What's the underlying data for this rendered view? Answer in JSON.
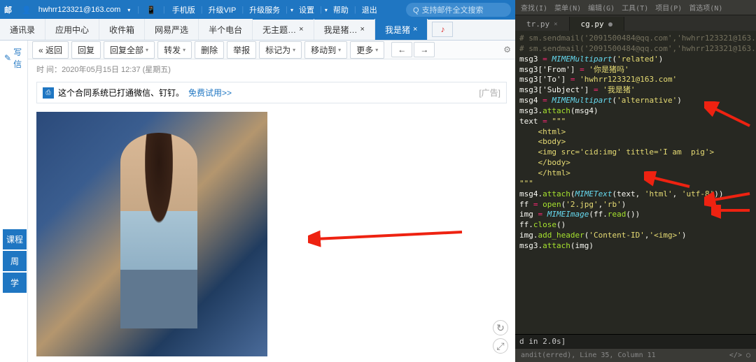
{
  "mail": {
    "brand": "邮",
    "user_email": "hwhrr123321@163.com",
    "top_links": [
      "手机版",
      "升级VIP",
      "升级服务",
      "设置",
      "帮助",
      "退出"
    ],
    "search_placeholder": "支持邮件全文搜索",
    "static_tabs": [
      "通讯录",
      "应用中心",
      "收件箱",
      "网易严选",
      "半个电台"
    ],
    "closable_tabs": [
      "无主题…",
      "我是猪…",
      "我是猪"
    ],
    "active_tab_index": 2,
    "compose": "写信",
    "toolbar": {
      "back": "« 返回",
      "reply": "回复",
      "reply_all": "回复全部",
      "forward": "转发",
      "delete": "删除",
      "report": "举报",
      "mark": "标记为",
      "move": "移动到",
      "more": "更多"
    },
    "meta": {
      "label": "时  间：",
      "value": "2020年05月15日 12:37 (星期五)"
    },
    "ad": {
      "text": "这个合同系统已打通微信、钉钉。",
      "link": "免费试用>>",
      "tag": "[广告]"
    },
    "side_labels": [
      "课程",
      "周",
      "学"
    ],
    "controls": {
      "rotate": "↻",
      "fit": "⤢"
    }
  },
  "editor": {
    "top_menu": [
      "查找(I)",
      "菜单(N)",
      "编辑(G)",
      "工具(T)",
      "项目(P)",
      "首选项(N)"
    ],
    "tabs": [
      {
        "name": "tr.py",
        "active": false
      },
      {
        "name": "cg.py",
        "active": true
      }
    ],
    "code_lines": [
      {
        "t": "cmt",
        "s": "# sm.sendmail('2091500484@qq.com','hwhrr123321@163."
      },
      {
        "t": "cmt",
        "s": "# sm.sendmail('2091500484@qq.com','hwhrr123321@163."
      },
      {
        "t": "assign",
        "v": "msg3",
        "rhs": [
          {
            "c": "fn",
            "s": "MIMEMultipart"
          },
          {
            "c": "",
            "s": "("
          },
          {
            "c": "str",
            "s": "'related'"
          },
          {
            "c": "",
            "s": ")"
          }
        ]
      },
      {
        "t": "assign",
        "v": "msg3['From']",
        "rhs": [
          {
            "c": "str",
            "s": "'你是猪吗'"
          }
        ]
      },
      {
        "t": "assign",
        "v": "msg3['To']",
        "rhs": [
          {
            "c": "str",
            "s": "'hwhrr123321@163.com'"
          }
        ]
      },
      {
        "t": "assign",
        "v": "msg3['Subject']",
        "rhs": [
          {
            "c": "str",
            "s": "'我是猪'"
          }
        ]
      },
      {
        "t": "assign",
        "v": "msg4",
        "rhs": [
          {
            "c": "fn",
            "s": "MIMEMultipart"
          },
          {
            "c": "",
            "s": "("
          },
          {
            "c": "str",
            "s": "'alternative'"
          },
          {
            "c": "",
            "s": ")"
          }
        ]
      },
      {
        "t": "stmt",
        "p": [
          {
            "c": "var",
            "s": "msg3."
          },
          {
            "c": "call",
            "s": "attach"
          },
          {
            "c": "",
            "s": "(msg4)"
          }
        ]
      },
      {
        "t": "assign",
        "v": "text",
        "rhs": [
          {
            "c": "str",
            "s": "\"\"\""
          }
        ]
      },
      {
        "t": "str",
        "s": "    <html>"
      },
      {
        "t": "str",
        "s": "    <body>"
      },
      {
        "t": "str",
        "s": "    <img src='cid:img' tittle='I am  pig'>"
      },
      {
        "t": "str",
        "s": "    </body>"
      },
      {
        "t": "str",
        "s": "    </html>"
      },
      {
        "t": "str",
        "s": "\"\"\""
      },
      {
        "t": "stmt",
        "p": [
          {
            "c": "var",
            "s": "msg4."
          },
          {
            "c": "call",
            "s": "attach"
          },
          {
            "c": "",
            "s": "("
          },
          {
            "c": "fn",
            "s": "MIMEText"
          },
          {
            "c": "",
            "s": "(text, "
          },
          {
            "c": "str",
            "s": "'html'"
          },
          {
            "c": "",
            "s": ", "
          },
          {
            "c": "str",
            "s": "'utf-8'"
          },
          {
            "c": "",
            "s": "))"
          }
        ]
      },
      {
        "t": "assign",
        "v": "ff",
        "op": "=",
        "rhs": [
          {
            "c": "call",
            "s": "open"
          },
          {
            "c": "",
            "s": "("
          },
          {
            "c": "str",
            "s": "'2.jpg'"
          },
          {
            "c": "",
            "s": ","
          },
          {
            "c": "str",
            "s": "'rb'"
          },
          {
            "c": "",
            "s": ")"
          }
        ]
      },
      {
        "t": "assign",
        "v": "img",
        "rhs": [
          {
            "c": "fn",
            "s": "MIMEImage"
          },
          {
            "c": "",
            "s": "(ff."
          },
          {
            "c": "call",
            "s": "read"
          },
          {
            "c": "",
            "s": "())"
          }
        ]
      },
      {
        "t": "stmt",
        "p": [
          {
            "c": "var",
            "s": "ff."
          },
          {
            "c": "call",
            "s": "close"
          },
          {
            "c": "",
            "s": "()"
          }
        ]
      },
      {
        "t": "stmt",
        "p": [
          {
            "c": "var",
            "s": "img."
          },
          {
            "c": "call",
            "s": "add_header"
          },
          {
            "c": "",
            "s": "("
          },
          {
            "c": "str",
            "s": "'Content-ID'"
          },
          {
            "c": "",
            "s": ","
          },
          {
            "c": "str",
            "s": "'<img>'"
          },
          {
            "c": "",
            "s": ")"
          }
        ]
      },
      {
        "t": "stmt",
        "p": [
          {
            "c": "var",
            "s": "msg3."
          },
          {
            "c": "call",
            "s": "attach"
          },
          {
            "c": "",
            "s": "(img)"
          }
        ]
      }
    ],
    "output": "d in 2.0s]",
    "status_left": "andit(erred), Line 35, Column 11",
    "status_right": "</>"
  }
}
